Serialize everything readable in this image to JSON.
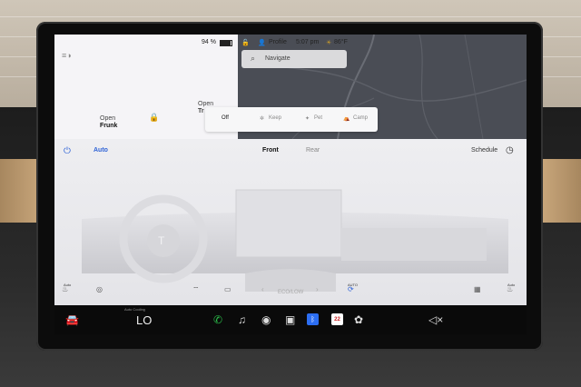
{
  "status_bar": {
    "battery": "94 %",
    "profile": "Profile",
    "time": "5:07 pm",
    "temperature": "86°F"
  },
  "vehicle": {
    "frunk_action": "Open",
    "frunk_label": "Frunk",
    "trunk_action": "Open",
    "trunk_label": "Tr"
  },
  "map": {
    "search_placeholder": "Navigate"
  },
  "climate_modes": {
    "off": "Off",
    "keep": "Keep",
    "pet": "Pet",
    "camp": "Camp"
  },
  "climate": {
    "auto": "Auto",
    "front": "Front",
    "rear": "Rear",
    "schedule": "Schedule",
    "seat_left_label": "Auto",
    "seat_right_label": "Auto",
    "fan_label": "AUTO",
    "fan_value": "ECO/LOW"
  },
  "dock": {
    "temp_caption": "Auto Cooling",
    "temp_value": "LO",
    "calendar_day": "22"
  },
  "colors": {
    "accent": "#2f63d6"
  }
}
